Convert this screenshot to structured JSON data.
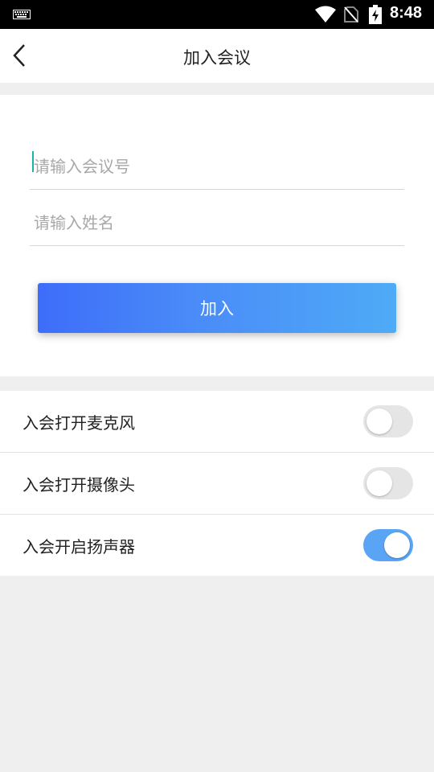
{
  "status_bar": {
    "time": "8:48",
    "icons": [
      "keyboard-icon",
      "wifi-icon",
      "no-sim-icon",
      "battery-charging-icon"
    ]
  },
  "app_bar": {
    "title": "加入会议",
    "back_icon": "back-arrow-icon"
  },
  "form": {
    "meeting_number_placeholder": "请输入会议号",
    "meeting_number_value": "",
    "name_placeholder": "请输入姓名",
    "name_value": "",
    "join_label": "加入"
  },
  "settings": [
    {
      "label": "入会打开麦克风",
      "enabled": false
    },
    {
      "label": "入会打开摄像头",
      "enabled": false
    },
    {
      "label": "入会开启扬声器",
      "enabled": true
    }
  ],
  "colors": {
    "accent": "#4a8cf8",
    "toggle_on": "#5aa4f5",
    "toggle_off": "#e5e5e5",
    "background": "#efefef"
  }
}
